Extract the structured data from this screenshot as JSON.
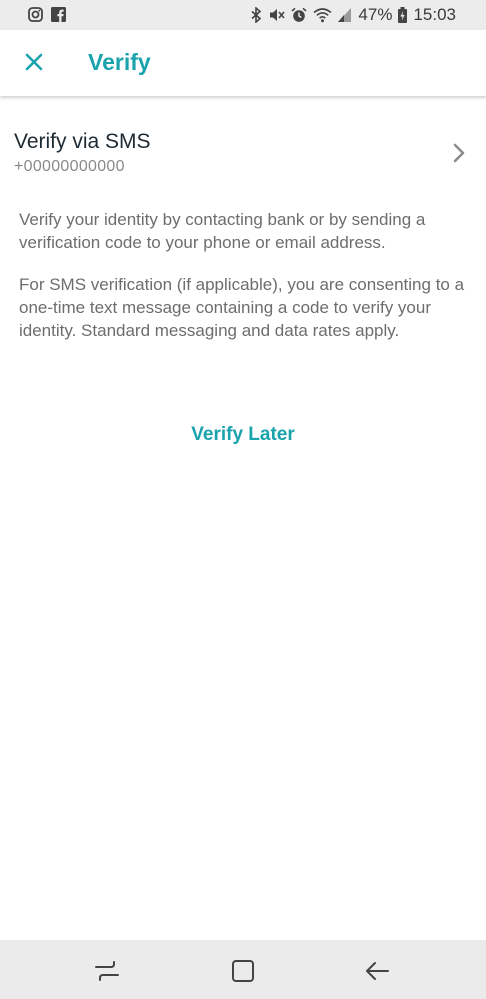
{
  "status_bar": {
    "battery": "47%",
    "time": "15:03",
    "left_icons": [
      "instagram-icon",
      "facebook-icon"
    ],
    "right_icons": [
      "bluetooth-icon",
      "mute-icon",
      "alarm-icon",
      "wifi-icon",
      "signal-icon",
      "battery-icon"
    ]
  },
  "app_bar": {
    "title": "Verify",
    "close_icon": "close-icon"
  },
  "sms_option": {
    "title": "Verify via SMS",
    "phone": "+00000000000",
    "chevron_icon": "chevron-right-icon"
  },
  "description": {
    "paragraph1": "Verify your identity by contacting bank or by sending a verification code to your phone or email address.",
    "paragraph2": "For SMS verification (if applicable), you are consenting to a one-time text message containing a code to verify your identity. Standard messaging and data rates apply."
  },
  "actions": {
    "verify_later": "Verify Later"
  },
  "nav_bar": {
    "icons": [
      "recent-apps-icon",
      "home-icon",
      "back-icon"
    ]
  },
  "colors": {
    "accent": "#1aa3ad",
    "title_text": "#1d2a33",
    "body_text": "#6d6d6d",
    "status_bar_bg": "#ececec",
    "nav_bar_bg": "#ebebeb"
  }
}
